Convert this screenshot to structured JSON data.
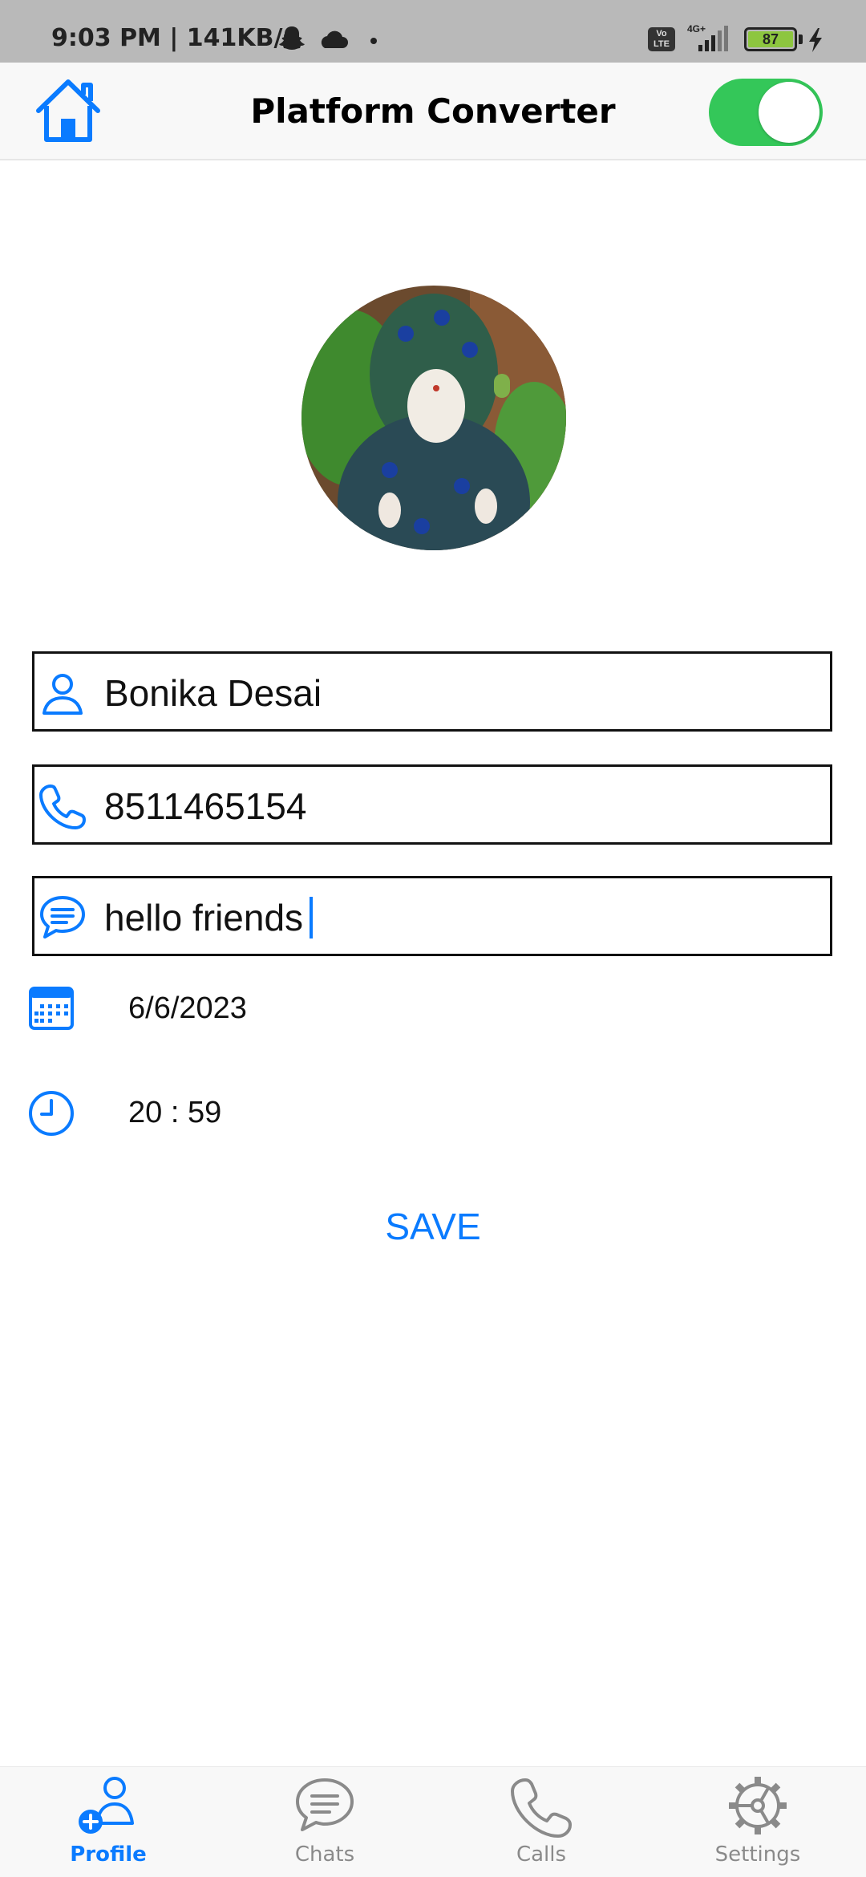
{
  "status_bar": {
    "time_speed": "9:03 PM | 141KB/s",
    "network": "4G+",
    "volte": "Vo LTE",
    "battery": "87"
  },
  "app_bar": {
    "title": "Platform Converter",
    "toggle_on": true
  },
  "form": {
    "name": "Bonika Desai",
    "phone": "8511465154",
    "message": "hello friends",
    "date": "6/6/2023",
    "time": "20 : 59",
    "save_label": "SAVE"
  },
  "bottom_nav": {
    "items": [
      {
        "label": "Profile",
        "icon": "add-person-icon",
        "active": true
      },
      {
        "label": "Chats",
        "icon": "chat-bubble-icon",
        "active": false
      },
      {
        "label": "Calls",
        "icon": "phone-icon",
        "active": false
      },
      {
        "label": "Settings",
        "icon": "settings-gear-icon",
        "active": false
      }
    ]
  },
  "colors": {
    "accent": "#0a7bff",
    "toggle_on": "#34c759",
    "inactive": "#8a8a8a",
    "bar_bg": "#f8f8f8",
    "status_bg": "#b9b9b9"
  }
}
